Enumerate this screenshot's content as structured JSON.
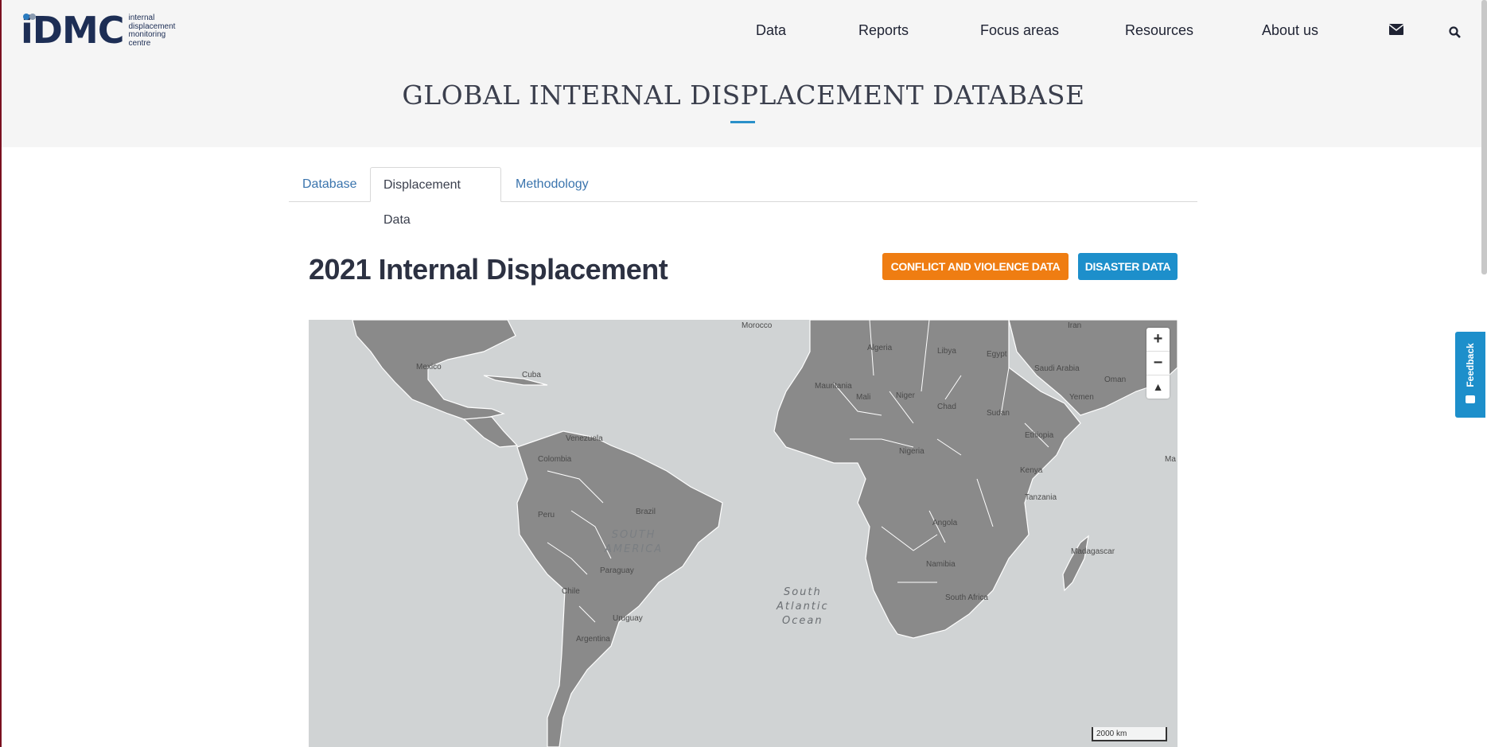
{
  "header": {
    "logo": {
      "mark": "iDMC",
      "words": [
        "internal",
        "displacement",
        "monitoring",
        "centre"
      ]
    },
    "nav": [
      "Data",
      "Reports",
      "Focus areas",
      "Resources",
      "About us"
    ],
    "icons": [
      "envelope-icon",
      "search-icon"
    ]
  },
  "page_heading": "GLOBAL INTERNAL DISPLACEMENT DATABASE",
  "tabs": [
    {
      "label": "Database",
      "active": false
    },
    {
      "label": "Displacement Data",
      "active": true
    },
    {
      "label": "Methodology",
      "active": false
    }
  ],
  "section_title": "2021 Internal Displacement",
  "buttons": {
    "conflict": "CONFLICT AND VIOLENCE DATA",
    "disaster": "DISASTER DATA"
  },
  "map": {
    "countries": [
      "Morocco",
      "Algeria",
      "Libya",
      "Egypt",
      "Iran",
      "Saudi Arabia",
      "Oman",
      "Mexico",
      "Cuba",
      "Mauritania",
      "Mali",
      "Niger",
      "Chad",
      "Sudan",
      "Yemen",
      "Venezuela",
      "Colombia",
      "Ethiopia",
      "Kenya",
      "Peru",
      "Brazil",
      "Tanzania",
      "Angola",
      "Namibia",
      "Paraguay",
      "Chile",
      "South Africa",
      "Uruguay",
      "Argentina",
      "Madagascar",
      "Nigeria"
    ],
    "region_label": [
      "SOUTH",
      "AMERICA"
    ],
    "ocean_label": [
      "South",
      "Atlantic",
      "Ocean"
    ],
    "edge_label": "Ma",
    "zoom_in": "+",
    "zoom_out": "−",
    "reset": "▲",
    "scale": "2000 km"
  },
  "feedback_label": "Feedback",
  "colors": {
    "accent_orange": "#ef7d12",
    "accent_blue": "#1d8fcb",
    "land": "#8a8a8a",
    "water": "#d0d3d4"
  }
}
